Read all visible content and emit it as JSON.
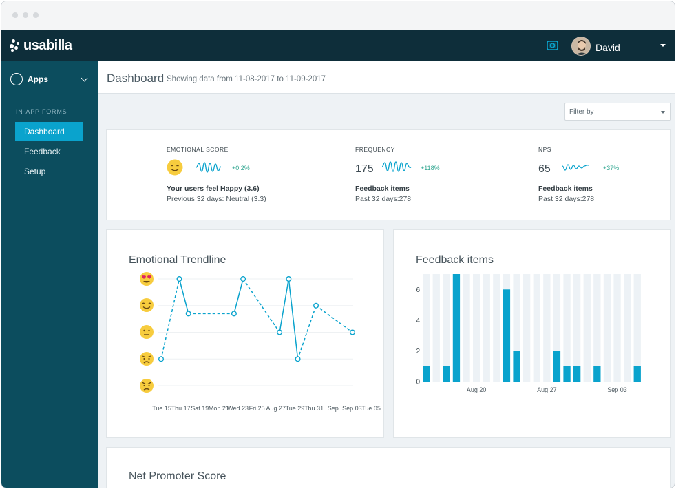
{
  "brand": {
    "name": "usabilla",
    "accent": "#0aa3cd",
    "topbar_color": "#0e2e3a",
    "sidebar_color": "#0c4d5e"
  },
  "topbar": {
    "notifications_icon": "support-icon",
    "user_name": "David"
  },
  "sidebar": {
    "apps_label": "Apps",
    "section_label": "IN-APP FORMS",
    "items": [
      {
        "label": "Dashboard",
        "active": true
      },
      {
        "label": "Feedback",
        "active": false
      },
      {
        "label": "Setup",
        "active": false
      }
    ]
  },
  "header": {
    "title": "Dashboard",
    "subtitle": "Showing data from 11-08-2017 to 11-09-2017"
  },
  "filter": {
    "placeholder": "Filter by"
  },
  "kpis": {
    "emotional": {
      "label": "EMOTIONAL SCORE",
      "delta": "+0.2%",
      "line1": "Your users feel Happy (3.6)",
      "line2": "Previous 32 days: Neutral (3.3)",
      "icon": "happy-emoji-icon"
    },
    "frequency": {
      "label": "FREQUENCY",
      "value": "175",
      "delta": "+118%",
      "line1": "Feedback items",
      "line2": "Past 32 days:278"
    },
    "nps": {
      "label": "NPS",
      "value": "65",
      "delta": "+37%",
      "line1": "Feedback items",
      "line2": "Past 32 days:278"
    }
  },
  "chart_data": [
    {
      "type": "line",
      "title": "Emotional Trendline",
      "x": [
        "Tue 15",
        "Thu 17",
        "Sat 19",
        "Mon 21",
        "Wed 23",
        "Fri 25",
        "Aug 27",
        "Tue 29",
        "Thu 31",
        "Sep",
        "Sep 03",
        "Tue 05"
      ],
      "y_scale": [
        1,
        2,
        3,
        4,
        5
      ],
      "y_scale_icons": [
        "angry-emoji-icon",
        "sad-emoji-icon",
        "neutral-emoji-icon",
        "happy-emoji-icon",
        "love-emoji-icon"
      ],
      "points": [
        {
          "day": 0,
          "score": 2.0
        },
        {
          "day": 2,
          "score": 5.0
        },
        {
          "day": 3,
          "score": 3.7
        },
        {
          "day": 8,
          "score": 3.7
        },
        {
          "day": 9,
          "score": 5.0
        },
        {
          "day": 13,
          "score": 3.0
        },
        {
          "day": 14,
          "score": 5.0
        },
        {
          "day": 15,
          "score": 2.0
        },
        {
          "day": 17,
          "score": 4.0
        },
        {
          "day": 21,
          "score": 3.0
        }
      ],
      "segments_solid": [
        [
          1,
          2
        ],
        [
          3,
          4
        ],
        [
          5,
          6
        ],
        [
          6,
          7
        ]
      ],
      "segments_dashed": [
        [
          0,
          1
        ],
        [
          2,
          3
        ],
        [
          4,
          5
        ],
        [
          7,
          8
        ],
        [
          8,
          9
        ]
      ],
      "day_range": [
        0,
        21
      ],
      "ylim": [
        1,
        5
      ]
    },
    {
      "type": "bar",
      "title": "Feedback items",
      "values": [
        1,
        0,
        1,
        7,
        0,
        0,
        0,
        0,
        6,
        2,
        0,
        0,
        0,
        2,
        1,
        1,
        0,
        1,
        0,
        0,
        0,
        1
      ],
      "capacity": 7,
      "x_tick_labels": [
        {
          "index": 5,
          "label": "Aug 20"
        },
        {
          "index": 12,
          "label": "Aug 27"
        },
        {
          "index": 19,
          "label": "Sep 03"
        }
      ],
      "y_ticks": [
        0,
        2,
        4,
        6
      ],
      "ylim": [
        0,
        7
      ],
      "bar_color": "#0aa3cd",
      "track_color": "#edf2f6"
    }
  ],
  "nps_card": {
    "title": "Net Promoter Score"
  }
}
